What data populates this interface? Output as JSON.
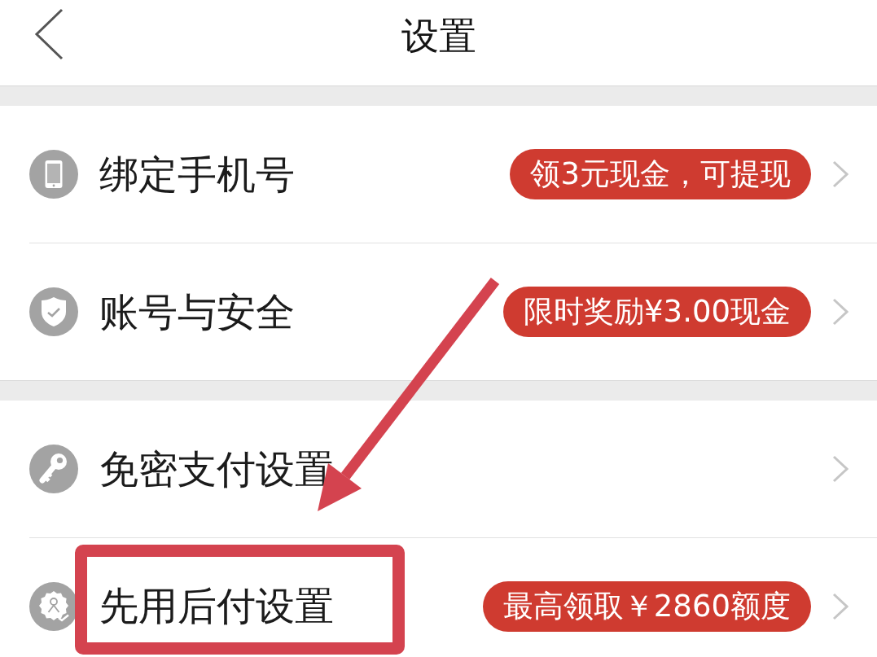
{
  "header": {
    "title": "设置"
  },
  "sections": [
    {
      "items": [
        {
          "label": "绑定手机号",
          "badge": "领3元现金，可提现",
          "highlighted": false
        },
        {
          "label": "账号与安全",
          "badge": "限时奖励¥3.00现金",
          "highlighted": false
        }
      ]
    },
    {
      "items": [
        {
          "label": "免密支付设置",
          "highlighted": false
        },
        {
          "label": "先用后付设置",
          "badge": "最高领取￥2860额度",
          "highlighted": true
        }
      ]
    }
  ],
  "annotation": {
    "arrow": true
  }
}
